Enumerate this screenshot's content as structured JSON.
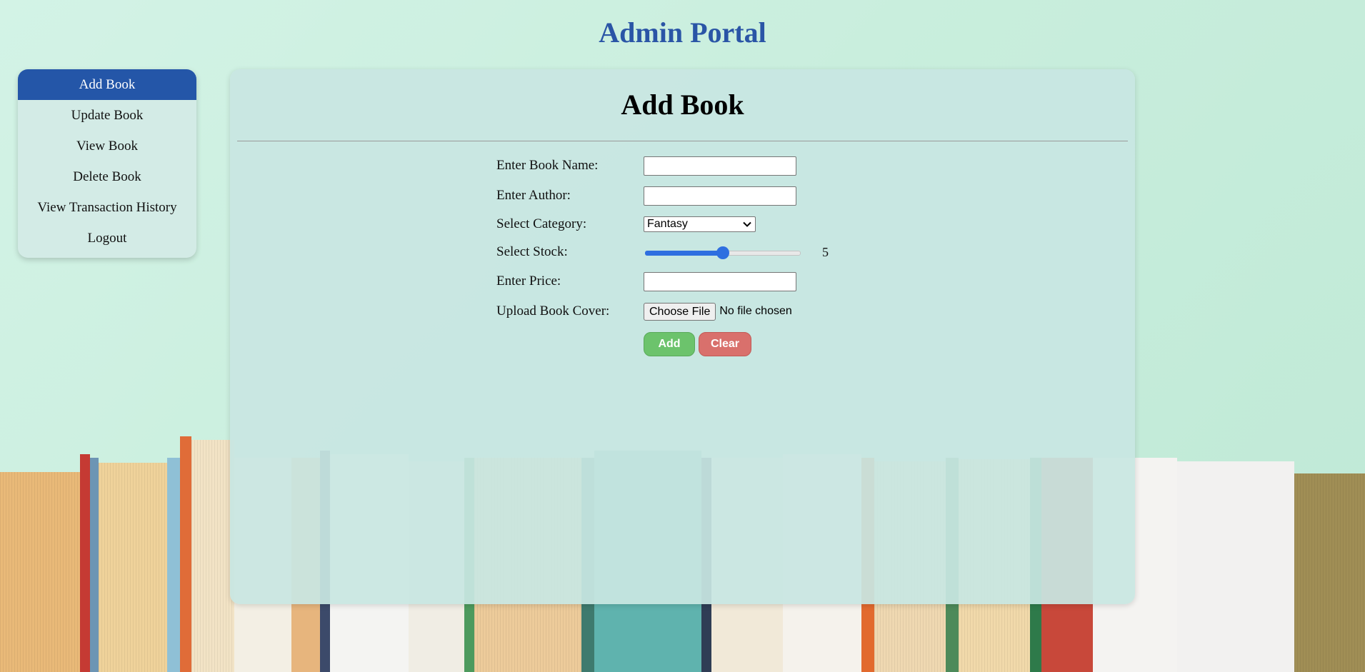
{
  "app": {
    "title": "Admin Portal"
  },
  "sidebar": {
    "items": [
      {
        "label": "Add Book",
        "active": true
      },
      {
        "label": "Update Book",
        "active": false
      },
      {
        "label": "View Book",
        "active": false
      },
      {
        "label": "Delete Book",
        "active": false
      },
      {
        "label": "View Transaction History",
        "active": false
      },
      {
        "label": "Logout",
        "active": false
      }
    ]
  },
  "main": {
    "heading": "Add Book",
    "form": {
      "book_name": {
        "label": "Enter Book Name:",
        "value": ""
      },
      "author": {
        "label": "Enter Author:",
        "value": ""
      },
      "category": {
        "label": "Select Category:",
        "selected": "Fantasy"
      },
      "stock": {
        "label": "Select Stock:",
        "value": "5",
        "fraction": 0.5
      },
      "price": {
        "label": "Enter Price:",
        "value": ""
      },
      "cover": {
        "label": "Upload Book Cover:",
        "button_label": "Choose File",
        "status": "No file chosen"
      },
      "add_label": "Add",
      "clear_label": "Clear"
    }
  },
  "colors": {
    "accent": "#2456a8",
    "title": "#2a55a6",
    "add_button": "#6cc36c",
    "clear_button": "#d9706c",
    "slider": "#2f6fe0"
  },
  "icons": {
    "category_dropdown": "chevron-down-icon"
  }
}
